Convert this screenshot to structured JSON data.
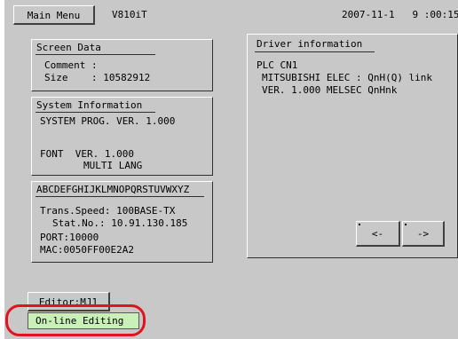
{
  "header": {
    "main_menu_label": "Main Menu",
    "model": "V810iT",
    "datetime": "2007-11-1   9 :00:15"
  },
  "screen_data": {
    "title": "Screen Data",
    "comment_line": "Comment :",
    "size_line": "Size    : 10582912"
  },
  "system_info": {
    "title": "System Information",
    "prog_line": "SYSTEM PROG. VER. 1.000",
    "font_line": "FONT  VER. 1.000",
    "lang_line": "MULTI LANG"
  },
  "network": {
    "title": "ABCDEFGHIJKLMNOPQRSTUVWXYZ",
    "speed_line": "Trans.Speed: 100BASE-TX",
    "station_line": "Stat.No.: 10.91.130.185",
    "port_line": "PORT:10000",
    "mac_line": "MAC:0050FF00E2A2"
  },
  "driver": {
    "title": "Driver information",
    "line1": "PLC CN1",
    "line2": "MITSUBISHI ELEC : QnH(Q) link",
    "line3": "VER. 1.000 MELSEC QnHnk",
    "prev_label": "<-",
    "next_label": "->"
  },
  "footer": {
    "editor_label": "Editor:MJ1",
    "online_label": "On-line Editing"
  },
  "colors": {
    "screen_bg": "#c8c8c8",
    "online_bg": "#c8f0b8",
    "highlight": "#e0141e"
  }
}
